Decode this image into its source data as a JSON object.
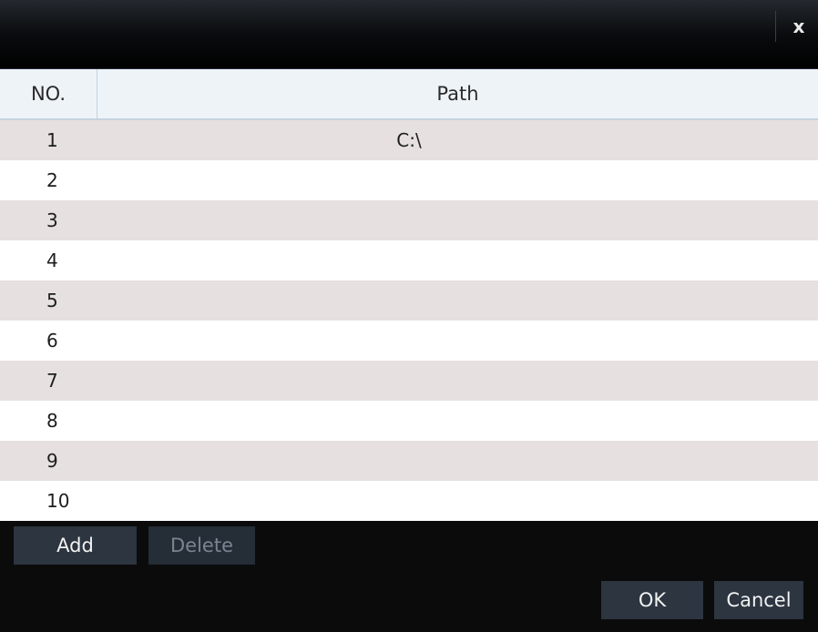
{
  "dialog": {
    "close_label": "x"
  },
  "table": {
    "headers": {
      "no": "NO.",
      "path": "Path"
    },
    "rows": [
      {
        "no": "1",
        "path": "C:\\"
      },
      {
        "no": "2",
        "path": ""
      },
      {
        "no": "3",
        "path": ""
      },
      {
        "no": "4",
        "path": ""
      },
      {
        "no": "5",
        "path": ""
      },
      {
        "no": "6",
        "path": ""
      },
      {
        "no": "7",
        "path": ""
      },
      {
        "no": "8",
        "path": ""
      },
      {
        "no": "9",
        "path": ""
      },
      {
        "no": "10",
        "path": ""
      }
    ]
  },
  "actions": {
    "add": "Add",
    "delete": "Delete",
    "ok": "OK",
    "cancel": "Cancel"
  },
  "colors": {
    "row_odd": "#e6e0e0",
    "row_even": "#ffffff",
    "header_bg": "#eef3f8",
    "button_bg": "#2c3540",
    "disabled_text": "#7b8591"
  }
}
